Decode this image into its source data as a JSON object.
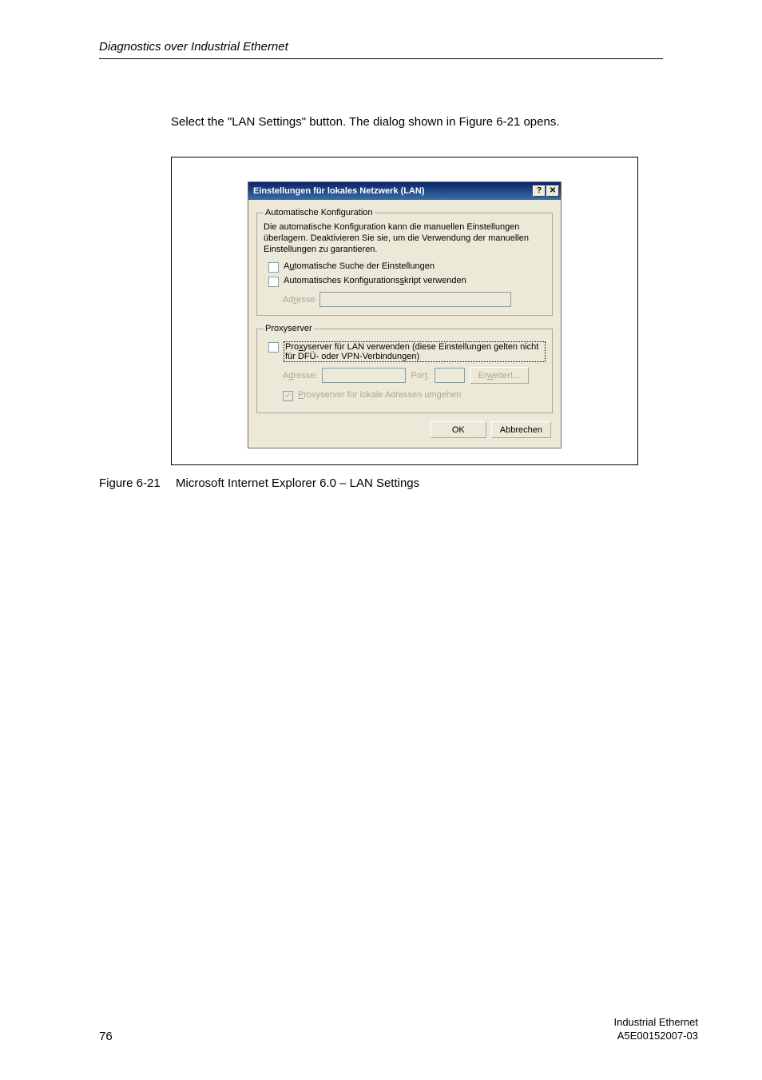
{
  "header": {
    "section": "Diagnostics over Industrial Ethernet"
  },
  "intro": "Select the \"LAN Settings\" button. The dialog shown in Figure 6-21 opens.",
  "dialog": {
    "title": "Einstellungen für lokales Netzwerk (LAN)",
    "help_symbol": "?",
    "close_symbol": "✕",
    "group_auto": {
      "legend": "Automatische Konfiguration",
      "description": "Die automatische Konfiguration kann die manuellen Einstellungen überlagern. Deaktivieren Sie sie, um die Verwendung der manuellen Einstellungen zu garantieren.",
      "chk_auto_detect": {
        "pre": "A",
        "hot": "u",
        "post": "tomatische Suche der Einstellungen"
      },
      "chk_auto_script": {
        "pre": "Automatisches Konfigurations",
        "hot": "s",
        "post": "kript verwenden"
      },
      "address_label": {
        "pre": "Ad",
        "hot": "r",
        "post": "esse"
      }
    },
    "group_proxy": {
      "legend": "Proxyserver",
      "chk_use_proxy": {
        "pre": "Pro",
        "hot": "x",
        "post": "yserver für LAN verwenden (diese Einstellungen gelten nicht für DFÜ- oder VPN-Verbindungen)"
      },
      "address_label": {
        "pre": "A",
        "hot": "d",
        "post": "resse:"
      },
      "port_label": {
        "pre": "Por",
        "hot": "t",
        "post": ":"
      },
      "advanced_btn": {
        "pre": "Er",
        "hot": "w",
        "post": "eitert..."
      },
      "chk_bypass": {
        "pre": "",
        "hot": "P",
        "post": "roxyserver für lokale Adressen umgehen"
      }
    },
    "ok_label": "OK",
    "cancel_label": "Abbrechen"
  },
  "figure": {
    "label": "Figure 6-21",
    "caption": "Microsoft Internet Explorer 6.0 – LAN Settings"
  },
  "footer": {
    "page": "76",
    "product": "Industrial Ethernet",
    "docnum": "A5E00152007-03"
  }
}
